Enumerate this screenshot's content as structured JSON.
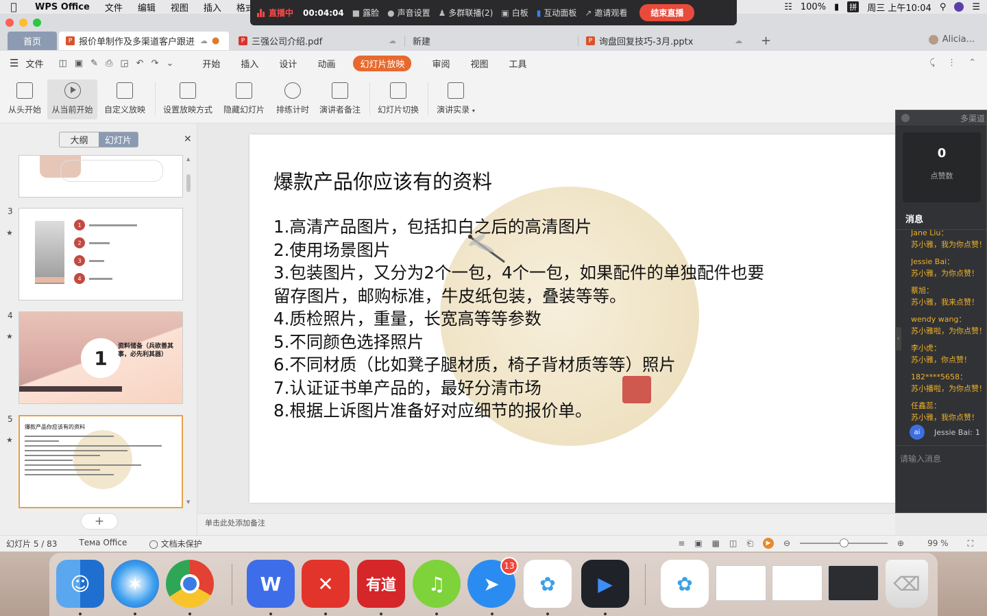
{
  "menubar": {
    "app_name": "WPS Office",
    "items": [
      "文件",
      "编辑",
      "视图",
      "插入",
      "格式"
    ],
    "battery": "100%",
    "input_method": "拼",
    "datetime": "周三 上午10:04"
  },
  "livebar": {
    "status": "直播中",
    "timer": "00:04:04",
    "items": [
      "露脸",
      "声音设置",
      "多群联播(2)",
      "白板",
      "互动面板",
      "邀请观看"
    ],
    "end_label": "结束直播"
  },
  "tabs": {
    "home": "首页",
    "items": [
      {
        "label": "报价单制作及多渠道客户跟进",
        "icon": "ppt-icon"
      },
      {
        "label": "三强公司介绍.pdf",
        "icon": "pdf-icon"
      },
      {
        "label": "新建",
        "icon": ""
      },
      {
        "label": "询盘回复技巧-3月.pptx",
        "icon": "ppt-icon"
      }
    ],
    "user": "Alicia..."
  },
  "ribbon": {
    "file": "文件",
    "tabs": [
      "开始",
      "插入",
      "设计",
      "动画",
      "幻灯片放映",
      "审阅",
      "视图",
      "工具"
    ],
    "active_tab": "幻灯片放映",
    "tools": [
      "从头开始",
      "从当前开始",
      "自定义放映",
      "设置放映方式",
      "隐藏幻灯片",
      "排练计时",
      "演讲者备注",
      "幻灯片切换",
      "演讲实录"
    ]
  },
  "left_panel": {
    "outline": "大纲",
    "slides": "幻灯片",
    "thumb_numbers": [
      "3",
      "4",
      "5"
    ],
    "thumb4_text": "资料储备（兵欲善其事，必先利其器）",
    "thumb4_number": "1",
    "thumb3_items": [
      "1",
      "2",
      "3",
      "4"
    ],
    "thumb5_title": "爆款产品你应该有的资料"
  },
  "slide": {
    "title": "爆款产品你应该有的资料",
    "lines": [
      "1.高清产品图片，包括扣白之后的高清图片",
      "2.使用场景图片",
      "3.包装图片，又分为2个一包，4个一包，如果配件的单独配件也要",
      "留存图片，邮购标准，牛皮纸包装，叠装等等。",
      "4.质检照片，重量，长宽高等等参数",
      "5.不同颜色选择照片",
      "6.不同材质（比如凳子腿材质，椅子背材质等等）照片",
      "7.认证证书单产品的，最好分清市场",
      "8.根据上诉图片准备好对应细节的报价单。"
    ]
  },
  "notes_placeholder": "单击此处添加备注",
  "statusbar": {
    "slide_count": "幻灯片 5 / 83",
    "theme": "Тема Office",
    "protect": "文档未保护",
    "zoom": "99 %"
  },
  "live_panel": {
    "header": "多渠道",
    "likes": "0",
    "likes_label": "点赞数",
    "messages_title": "消息",
    "messages": [
      {
        "who": "Jane Liu：",
        "text": "苏小雅，我为你点赞！"
      },
      {
        "who": "Jessie Bai：",
        "text": "苏小雅，为你点赞！"
      },
      {
        "who": "蔡旭：",
        "text": "苏小雅，我来点赞！"
      },
      {
        "who": "wendy wang：",
        "text": "苏小雅啦，为你点赞！"
      },
      {
        "who": "李小虎：",
        "text": "苏小雅，你点赞！"
      },
      {
        "who": "182****5658：",
        "text": "苏小播啦，为你点赞！"
      },
      {
        "who": "任鑫蕊：",
        "text": "苏小雅，我你点赞！"
      }
    ],
    "join_avatar": "ai",
    "join_name": "Jessie Bai:",
    "join_count": "1",
    "input_placeholder": "请输入消息"
  },
  "dock": {
    "badge": "13",
    "youdao": "有道"
  }
}
